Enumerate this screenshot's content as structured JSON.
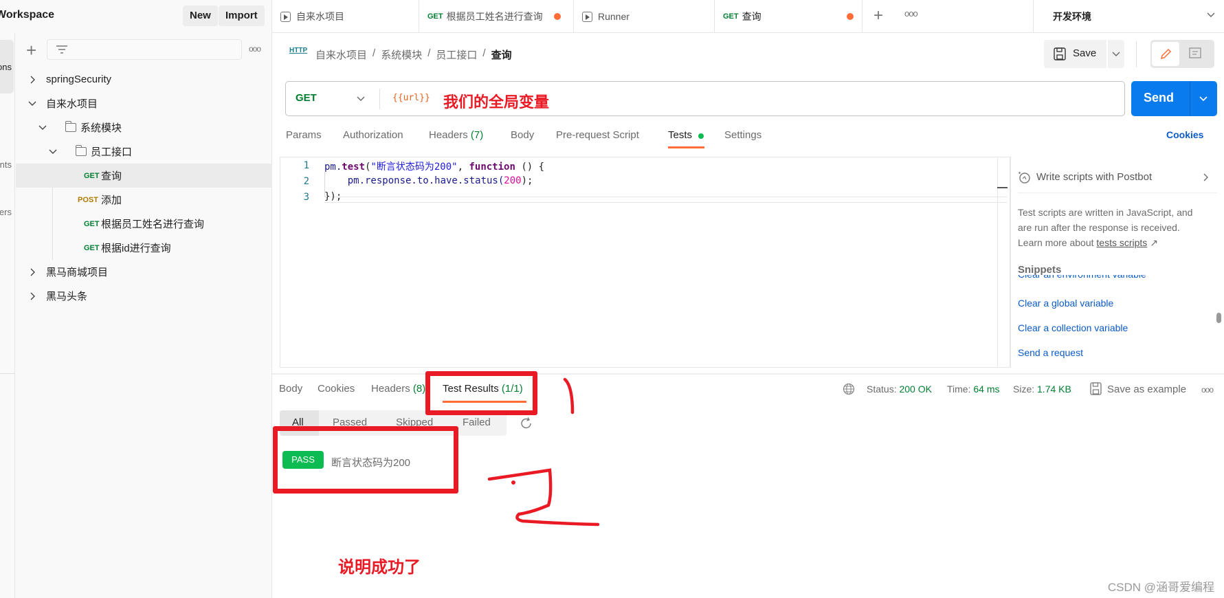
{
  "workspace": {
    "title": "Workspace",
    "new_label": "New",
    "import_label": "Import"
  },
  "tabs": [
    {
      "type": "runner",
      "label": "自来水项目",
      "modified": false
    },
    {
      "method": "GET",
      "label": "根据员工姓名进行查询",
      "modified": true
    },
    {
      "type": "runner",
      "label": "Runner",
      "modified": false
    },
    {
      "method": "GET",
      "label": "查询",
      "modified": true,
      "active": true
    }
  ],
  "environment": {
    "selected": "开发环境"
  },
  "rail": {
    "items": [
      "Collections",
      "Environments",
      "Mock servers"
    ]
  },
  "sidebar": {
    "tree": [
      {
        "label": "springSecurity",
        "expanded": false
      },
      {
        "label": "自来水项目",
        "expanded": true
      },
      {
        "label": "系统模块",
        "expanded": true,
        "folder": true
      },
      {
        "label": "员工接口",
        "expanded": true,
        "folder": true
      },
      {
        "method": "GET",
        "label": "查询",
        "selected": true
      },
      {
        "method": "POST",
        "label": "添加"
      },
      {
        "method": "GET",
        "label": "根据员工姓名进行查询"
      },
      {
        "method": "GET",
        "label": "根据id进行查询"
      },
      {
        "label": "黑马商城项目",
        "expanded": false
      },
      {
        "label": "黑马头条",
        "expanded": false
      }
    ]
  },
  "breadcrumb": {
    "icon": "HTTP",
    "parts": [
      "自来水项目",
      "系统模块",
      "员工接口"
    ],
    "current": "查询"
  },
  "toolbar": {
    "save_label": "Save"
  },
  "request": {
    "method": "GET",
    "url": "{{url}}",
    "send_label": "Send"
  },
  "request_tabs": {
    "params": "Params",
    "authorization": "Authorization",
    "headers": "Headers",
    "headers_count": "(7)",
    "body": "Body",
    "prerequest": "Pre-request Script",
    "tests": "Tests",
    "settings": "Settings",
    "cookies": "Cookies"
  },
  "editor": {
    "line_numbers": [
      "1",
      "2",
      "3"
    ],
    "line1": {
      "a": "pm.",
      "b": "test",
      "c": "(",
      "d": "\"断言状态码为200\"",
      "e": ", ",
      "f": "function",
      "g": " () {"
    },
    "line2": {
      "a": "    pm.response.to.have.status(",
      "b": "200",
      "c": ");"
    },
    "line3": "});"
  },
  "side_panel": {
    "postbot": "Write scripts with Postbot",
    "desc1": "Test scripts are written in JavaScript, and",
    "desc2": "are run after the response is received.",
    "desc3": "Learn more about ",
    "link": "tests scripts",
    "snippets_title": "Snippets",
    "snippets": [
      "Clear an environment variable",
      "Clear a global variable",
      "Clear a collection variable",
      "Send a request"
    ]
  },
  "response": {
    "tabs": {
      "body": "Body",
      "cookies": "Cookies",
      "headers": "Headers",
      "headers_count": "(8)",
      "test_results": "Test Results",
      "test_count": "(1/1)"
    },
    "status_label": "Status:",
    "status": "200 OK",
    "time_label": "Time:",
    "time": "64 ms",
    "size_label": "Size:",
    "size": "1.74 KB",
    "save_example": "Save as example",
    "filters": [
      "All",
      "Passed",
      "Skipped",
      "Failed"
    ],
    "results": [
      {
        "status": "PASS",
        "name": "断言状态码为200"
      }
    ]
  },
  "annotations": {
    "url_note": "我们的全局变量",
    "mark1": "1",
    "mark2": "2",
    "success_note": "说明成功了"
  },
  "watermark": "CSDN @涵哥爱编程",
  "colors": {
    "accent": "#ff6c37",
    "send": "#097bed",
    "pass": "#0cbb52",
    "annotation": "#ea1a24"
  }
}
